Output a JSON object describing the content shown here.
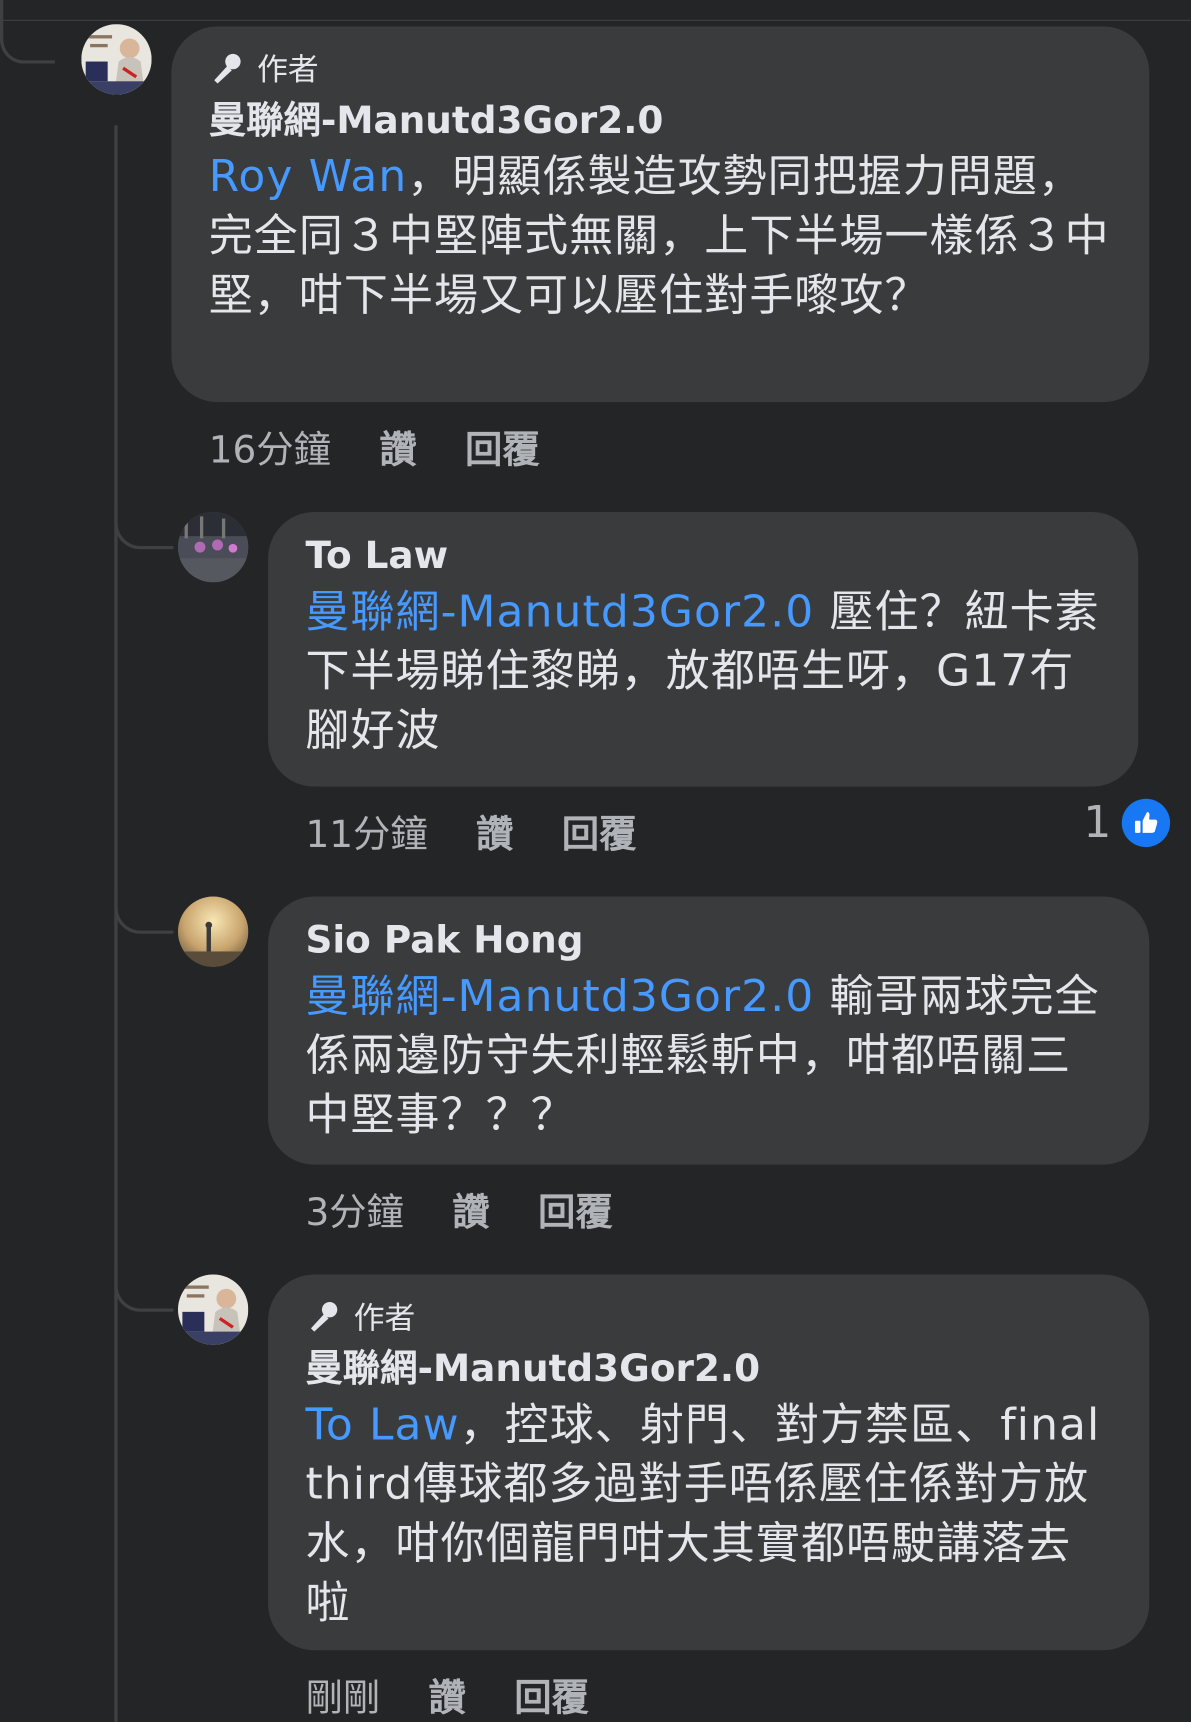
{
  "comments": [
    {
      "author_badge": "作者",
      "name": "曼聯網-Manutd3Gor2.0",
      "mention": "Roy Wan",
      "text": "，明顯係製造攻勢同把握力問題，完全同３中堅陣式無關，上下半場一樣係３中堅，咁下半場又可以壓住對手嚟攻？",
      "time": "16分鐘",
      "like_label": "讚",
      "reply_label": "回覆"
    },
    {
      "name": "To Law",
      "mention": "曼聯網-Manutd3Gor2.0",
      "text": " 壓住？紐卡素下半場睇住黎睇，放都唔生呀，G17冇腳好波",
      "time": "11分鐘",
      "like_label": "讚",
      "reply_label": "回覆",
      "reaction_count": "1"
    },
    {
      "name": "Sio Pak Hong",
      "mention": "曼聯網-Manutd3Gor2.0",
      "text": " 輸哥兩球完全係兩邊防守失利輕鬆斬中，咁都唔關三中堅事？？？",
      "time": "3分鐘",
      "like_label": "讚",
      "reply_label": "回覆"
    },
    {
      "author_badge": "作者",
      "name": "曼聯網-Manutd3Gor2.0",
      "mention": "To Law",
      "text": "，控球、射門、對方禁區、final third傳球都多過對手唔係壓住係對方放水，咁你個龍門咁大其實都唔駛講落去啦",
      "time": "剛剛",
      "like_label": "讚",
      "reply_label": "回覆"
    }
  ],
  "colors": {
    "background": "#242526",
    "bubble": "#3a3b3c",
    "text": "#e4e6eb",
    "secondary": "#b0b3b8",
    "mention": "#4599ff",
    "like_blue": "#1877f2"
  },
  "icons": {
    "author_badge": "microphone-icon",
    "reaction": "thumbs-up-icon"
  }
}
